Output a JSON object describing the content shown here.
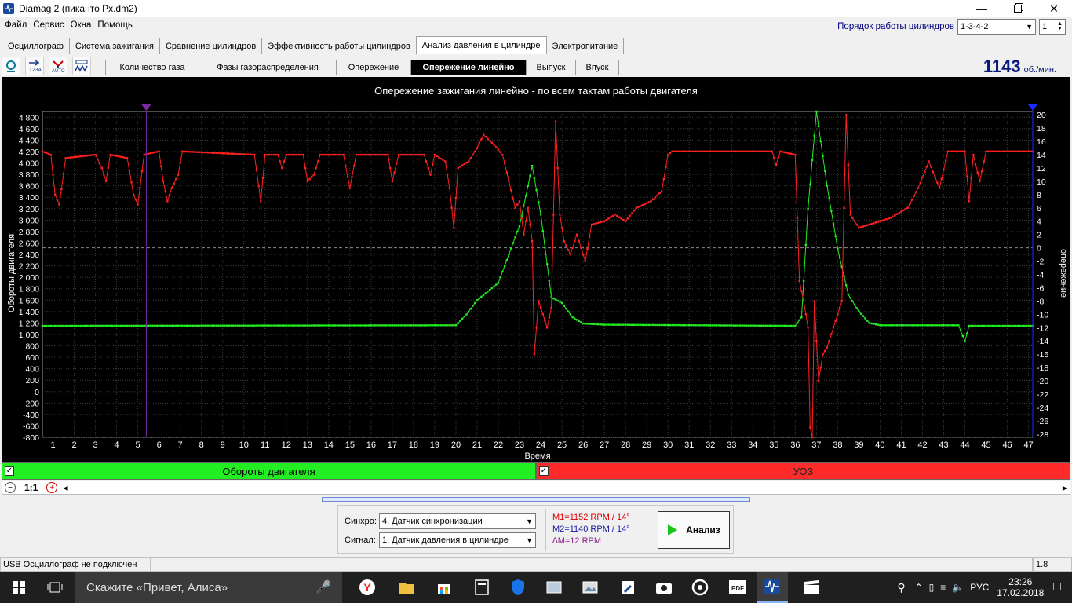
{
  "window": {
    "title": "Diamag 2 (пиканто Px.dm2)"
  },
  "menu": [
    "Файл",
    "Сервис",
    "Окна",
    "Помощь"
  ],
  "cylinder_order": {
    "label": "Порядок работы цилиндров",
    "value": "1-3-4-2",
    "count": "1"
  },
  "tabs": [
    "Осциллограф",
    "Система зажигания",
    "Сравнение цилиндров",
    "Эффективность работы цилиндров",
    "Анализ давления в цилиндре",
    "Электропитание"
  ],
  "active_tab": "Анализ давления в цилиндре",
  "subtabs": [
    "Количество газа",
    "Фазы газораспределения",
    "Опережение",
    "Опережение линейно",
    "Выпуск",
    "Впуск"
  ],
  "active_subtab": "Опережение линейно",
  "rpm": {
    "value": "1143",
    "unit": "об./мин."
  },
  "chart_data": {
    "type": "line",
    "title": "Опережение зажигания линейно - по всем тактам работы двигателя",
    "xlabel": "Время",
    "ylabel_left": "Обороты двигателя",
    "ylabel_right": "опережение",
    "xlim": [
      0.5,
      47.2
    ],
    "x_ticks": [
      1,
      2,
      3,
      4,
      5,
      6,
      7,
      8,
      9,
      10,
      11,
      12,
      13,
      14,
      15,
      16,
      17,
      18,
      19,
      20,
      21,
      22,
      23,
      24,
      25,
      26,
      27,
      28,
      29,
      30,
      31,
      32,
      33,
      34,
      35,
      36,
      37,
      38,
      39,
      40,
      41,
      42,
      43,
      44,
      45,
      46,
      47
    ],
    "ylim_left": [
      -800,
      4900
    ],
    "y_ticks_left": [
      -800,
      -600,
      -400,
      -200,
      0,
      200,
      400,
      600,
      800,
      1000,
      1200,
      1400,
      1600,
      1800,
      2000,
      2200,
      2400,
      2600,
      2800,
      3000,
      3200,
      3400,
      3600,
      3800,
      4000,
      4200,
      4400,
      4600,
      4800
    ],
    "ylim_right": [
      -28.5,
      20.5
    ],
    "y_ticks_right": [
      -28,
      -26,
      -24,
      -22,
      -20,
      -18,
      -16,
      -14,
      -12,
      -10,
      -8,
      -6,
      -4,
      -2,
      0,
      2,
      4,
      6,
      8,
      10,
      12,
      14,
      16,
      18,
      20
    ],
    "markers": [
      {
        "x": 5.4,
        "color": "#7a2aa0"
      },
      {
        "x": 47.2,
        "color": "#1a2aff"
      }
    ],
    "series": [
      {
        "name": "Обороты двигателя",
        "axis": "left",
        "color": "#22ee22",
        "points": [
          [
            0.5,
            1150
          ],
          [
            20,
            1160
          ],
          [
            20.5,
            1350
          ],
          [
            21,
            1600
          ],
          [
            22,
            1900
          ],
          [
            22.5,
            2400
          ],
          [
            23,
            2900
          ],
          [
            23.6,
            3950
          ],
          [
            24,
            3100
          ],
          [
            24.5,
            1650
          ],
          [
            25,
            1550
          ],
          [
            25.5,
            1300
          ],
          [
            26,
            1190
          ],
          [
            27,
            1170
          ],
          [
            36,
            1150
          ],
          [
            36.3,
            1300
          ],
          [
            36.6,
            3200
          ],
          [
            37,
            4900
          ],
          [
            37.5,
            3600
          ],
          [
            38,
            2500
          ],
          [
            38.5,
            1700
          ],
          [
            39,
            1400
          ],
          [
            39.5,
            1200
          ],
          [
            40,
            1160
          ],
          [
            43.7,
            1160
          ],
          [
            44,
            880
          ],
          [
            44.2,
            1150
          ],
          [
            47.2,
            1150
          ]
        ]
      },
      {
        "name": "УОЗ",
        "axis": "right",
        "color": "#ff2020",
        "points": [
          [
            0.5,
            14.5
          ],
          [
            0.9,
            14
          ],
          [
            1.1,
            8
          ],
          [
            1.3,
            6.5
          ],
          [
            1.6,
            13.5
          ],
          [
            3,
            14
          ],
          [
            3.3,
            12
          ],
          [
            3.5,
            10
          ],
          [
            3.7,
            14
          ],
          [
            4.5,
            13.5
          ],
          [
            4.8,
            8
          ],
          [
            5,
            6.5
          ],
          [
            5.3,
            14
          ],
          [
            6,
            14.5
          ],
          [
            6.2,
            10
          ],
          [
            6.4,
            7
          ],
          [
            6.6,
            9
          ],
          [
            6.9,
            11
          ],
          [
            7.1,
            14.5
          ],
          [
            10.5,
            14
          ],
          [
            10.8,
            7
          ],
          [
            11,
            14
          ],
          [
            11.6,
            14
          ],
          [
            11.8,
            12
          ],
          [
            12,
            14
          ],
          [
            12.8,
            14
          ],
          [
            13,
            10
          ],
          [
            13.3,
            11
          ],
          [
            13.6,
            14
          ],
          [
            14.7,
            14
          ],
          [
            15,
            9
          ],
          [
            15.3,
            14
          ],
          [
            16.8,
            14
          ],
          [
            17,
            10
          ],
          [
            17.3,
            14
          ],
          [
            18.5,
            14
          ],
          [
            18.8,
            11
          ],
          [
            19,
            14
          ],
          [
            19.5,
            13
          ],
          [
            19.7,
            9
          ],
          [
            19.9,
            3
          ],
          [
            20.1,
            12
          ],
          [
            20.6,
            13
          ],
          [
            21,
            15
          ],
          [
            21.3,
            17
          ],
          [
            21.8,
            15.5
          ],
          [
            22.2,
            14
          ],
          [
            22.5,
            10
          ],
          [
            22.8,
            6
          ],
          [
            23,
            7
          ],
          [
            23.2,
            2
          ],
          [
            23.4,
            6
          ],
          [
            23.6,
            1
          ],
          [
            23.7,
            -16
          ],
          [
            23.9,
            -8
          ],
          [
            24.1,
            -10
          ],
          [
            24.3,
            -12
          ],
          [
            24.5,
            -9
          ],
          [
            24.7,
            19
          ],
          [
            24.9,
            5
          ],
          [
            25.1,
            1
          ],
          [
            25.4,
            -1
          ],
          [
            25.7,
            2
          ],
          [
            26.1,
            -2
          ],
          [
            26.4,
            3.5
          ],
          [
            27,
            4
          ],
          [
            27.5,
            5
          ],
          [
            28,
            4
          ],
          [
            28.5,
            6
          ],
          [
            29.2,
            7
          ],
          [
            29.7,
            8.5
          ],
          [
            30,
            14
          ],
          [
            30.2,
            14.5
          ],
          [
            33,
            14.5
          ],
          [
            34.9,
            14.5
          ],
          [
            35.1,
            12.5
          ],
          [
            35.3,
            14.5
          ],
          [
            36,
            14
          ],
          [
            36.2,
            -5
          ],
          [
            36.4,
            -8
          ],
          [
            36.6,
            -12
          ],
          [
            36.7,
            -27
          ],
          [
            36.8,
            -28.5
          ],
          [
            36.9,
            -8
          ],
          [
            37.1,
            -20
          ],
          [
            37.3,
            -16
          ],
          [
            37.5,
            -15
          ],
          [
            37.7,
            -13
          ],
          [
            38,
            -10
          ],
          [
            38.2,
            -8
          ],
          [
            38.4,
            20
          ],
          [
            38.6,
            5
          ],
          [
            38.8,
            4
          ],
          [
            39,
            3
          ],
          [
            39.5,
            3.5
          ],
          [
            40.5,
            4.5
          ],
          [
            41.3,
            6
          ],
          [
            41.8,
            9
          ],
          [
            42.3,
            13
          ],
          [
            42.8,
            9
          ],
          [
            43.2,
            14.5
          ],
          [
            44,
            14.5
          ],
          [
            44.2,
            7
          ],
          [
            44.4,
            14
          ],
          [
            44.7,
            10
          ],
          [
            45,
            14.5
          ],
          [
            47.2,
            14.5
          ]
        ]
      }
    ]
  },
  "legend": {
    "series1": "Обороты двигателя",
    "series2": "УОЗ"
  },
  "zoom": "1:1",
  "sync": {
    "label": "Синхро:",
    "value": "4.  Датчик синхронизации"
  },
  "signal": {
    "label": "Сигнал:",
    "value": "1.  Датчик давления в цилиндре"
  },
  "measurements": {
    "m1": "M1=1152 RPM / 14°",
    "m2": "M2=1140 RPM / 14°",
    "dm": "∆M=12 RPM"
  },
  "analyze_button": "Анализ",
  "status": {
    "left": "USB Осциллограф не подключен",
    "right": "1.8"
  },
  "taskbar": {
    "search": "Скажите «Привет, Алиса»",
    "lang": "РУС",
    "time": "23:26",
    "date": "17.02.2018"
  },
  "colors": {
    "rpm_series": "#22ee22",
    "uoz_series": "#ff2020",
    "legend_green": "#22ee22",
    "legend_red": "#ff2a2a"
  }
}
